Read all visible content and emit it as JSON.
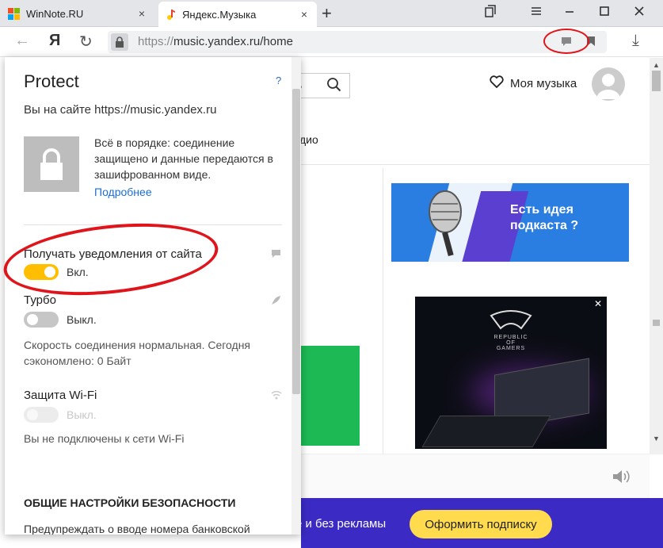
{
  "tabs": [
    {
      "label": "WinNote.RU",
      "close": "×"
    },
    {
      "label": "Яндекс.Музыка",
      "close": "×"
    }
  ],
  "new_tab": "+",
  "toolbar": {
    "back": "←",
    "logo": "Я",
    "reload": "↻",
    "url_proto": "https://",
    "url_rest": "music.yandex.ru/home",
    "download": "⤓"
  },
  "page": {
    "search_tail": "ь",
    "my_music": "Моя музыка",
    "radio_tab": "дио",
    "podcast_text": "Есть идея подкаста ?",
    "ad_close": "✕",
    "ad_brand": "REPUBLIC OF GAMERS",
    "promo_text": "е и без рекламы",
    "subscribe": "Оформить подписку"
  },
  "popup": {
    "title": "Protect",
    "help": "?",
    "site": "Вы на сайте https://music.yandex.ru",
    "secure_text": "Всё в порядке: соединение защищено и данные передаются в зашифрованном виде.",
    "more_link": "Подробнее",
    "notifications_label": "Получать уведомления от сайта",
    "notifications_state": "Вкл.",
    "turbo_label": "Турбо",
    "turbo_state": "Выкл.",
    "turbo_note": "Скорость соединения нормальная. Сегодня сэкономлено: 0 Байт",
    "wifi_label": "Защита Wi-Fi",
    "wifi_state": "Выкл.",
    "wifi_note": "Вы не подключены к сети Wi-Fi",
    "section_title": "ОБЩИЕ НАСТРОЙКИ БЕЗОПАСНОСТИ",
    "bottom_text": "Предупреждать о вводе номера банковской"
  },
  "colors": {
    "accent": "#ffbe00",
    "annotation": "#e0151b",
    "link": "#1a6fd6"
  }
}
